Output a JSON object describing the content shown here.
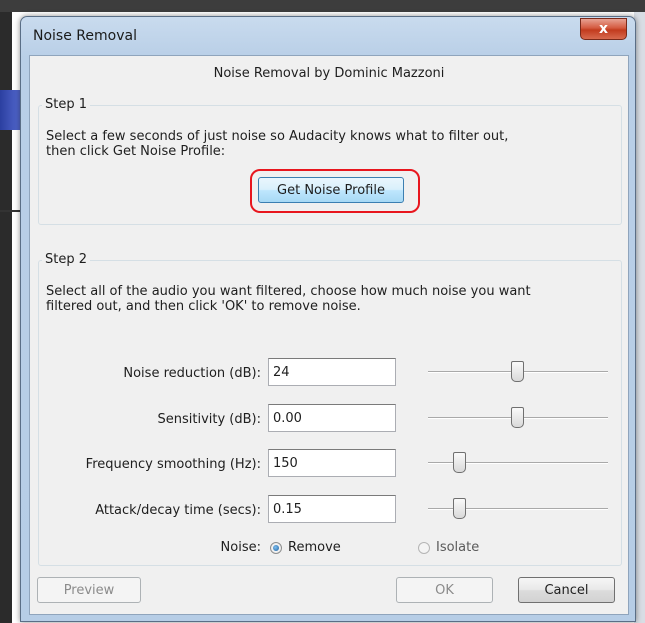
{
  "window": {
    "title": "Noise Removal",
    "close_label": "x"
  },
  "header": "Noise Removal by Dominic Mazzoni",
  "step1": {
    "label": "Step 1",
    "text_line1": "Select a few seconds of just noise so Audacity knows what to filter out,",
    "text_line2": "then click Get Noise Profile:",
    "button": "Get Noise Profile"
  },
  "step2": {
    "label": "Step 2",
    "text_line1": "Select all of the audio you want filtered, choose how much noise you want",
    "text_line2": "filtered out, and then click 'OK' to remove noise.",
    "rows": [
      {
        "label": "Noise reduction (dB):",
        "value": "24",
        "slider_fraction": 0.49
      },
      {
        "label": "Sensitivity (dB):",
        "value": "0.00",
        "slider_fraction": 0.49
      },
      {
        "label": "Frequency smoothing (Hz):",
        "value": "150",
        "slider_fraction": 0.15
      },
      {
        "label": "Attack/decay time (secs):",
        "value": "0.15",
        "slider_fraction": 0.15
      }
    ],
    "noise": {
      "label": "Noise:",
      "options": [
        "Remove",
        "Isolate"
      ],
      "selected": "Remove"
    }
  },
  "footer": {
    "preview": "Preview",
    "ok": "OK",
    "cancel": "Cancel"
  },
  "colors": {
    "highlight_ring": "#e8161e",
    "title_bar": "#b9cfe7"
  }
}
